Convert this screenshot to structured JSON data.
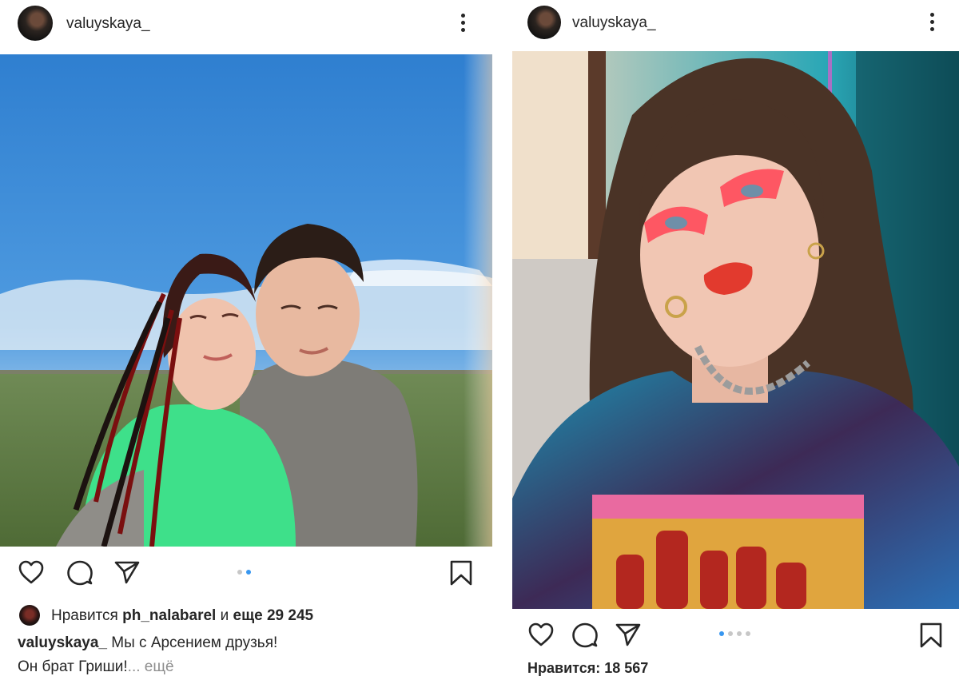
{
  "post1": {
    "username": "valuyskaya_",
    "photo_alt": "",
    "likes_prefix": "Нравится",
    "likes_user": "ph_nalabarel",
    "likes_middle": "и",
    "likes_more": "еще 29 245",
    "caption_user": "valuyskaya_",
    "caption_line1": "Мы с Арсением друзья!",
    "caption_line2": "Он брат Гриши!",
    "caption_more": "... ещё",
    "carousel": {
      "total": 2,
      "active": 2
    }
  },
  "post2": {
    "username": "valuyskaya_",
    "likes_text": "Нравится: 18 567",
    "carousel": {
      "total": 4,
      "active": 1
    }
  },
  "icons": [
    "more-vertical-icon",
    "heart-icon",
    "comment-icon",
    "share-icon",
    "bookmark-icon"
  ],
  "colors": {
    "accent": "#3897f0",
    "text": "#262626",
    "muted": "#8e8e8e"
  }
}
